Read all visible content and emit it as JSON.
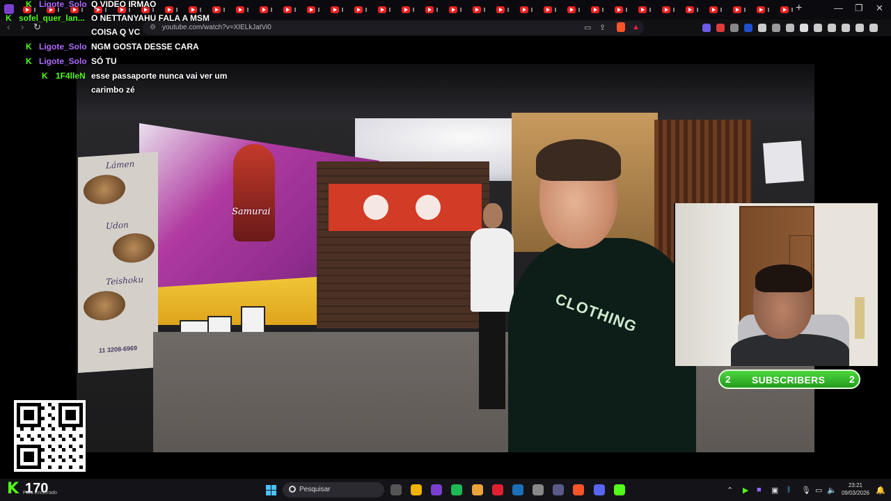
{
  "browser": {
    "url": "youtube.com/watch?v=XIELkJatVi0",
    "tab_count_label": "",
    "tab_icon": "youtube-favicon",
    "new_tab_icon": "plus-icon"
  },
  "chat": {
    "messages": [
      {
        "user": "Ligote_Solo",
        "user_color": "#b26bff",
        "text": "Q VIDEO IRMAO"
      },
      {
        "user": "sofel_quer_lan...",
        "user_color": "#53fc18",
        "text": "O NETTANYAHU FALA A MSM COISA Q VC"
      },
      {
        "user": "Ligote_Solo",
        "user_color": "#b26bff",
        "text": "NGM GOSTA DESSE CARA"
      },
      {
        "user": "Ligote_Solo",
        "user_color": "#b26bff",
        "text": "SÓ TU"
      },
      {
        "user": "1F4lleN",
        "user_color": "#53fc18",
        "text": "esse passaporte nunca vai ver um carimbo zé"
      }
    ]
  },
  "video": {
    "mural_brand": "Samurai",
    "menu_items": [
      "Lámen",
      "Udon",
      "Teishoku"
    ],
    "menu_phone": "11 3208-6969",
    "shirt_text": "CLOTHING"
  },
  "subscribers": {
    "label": "SUBSCRIBERS",
    "left_count": "2",
    "right_count": "2",
    "color": "#3cc232"
  },
  "viewers": {
    "count": "170",
    "status": "Para Encerrado",
    "color": "#53fc18"
  },
  "taskbar": {
    "search_placeholder": "Pesquisar",
    "time": "23:21",
    "date": "09/03/2026"
  }
}
